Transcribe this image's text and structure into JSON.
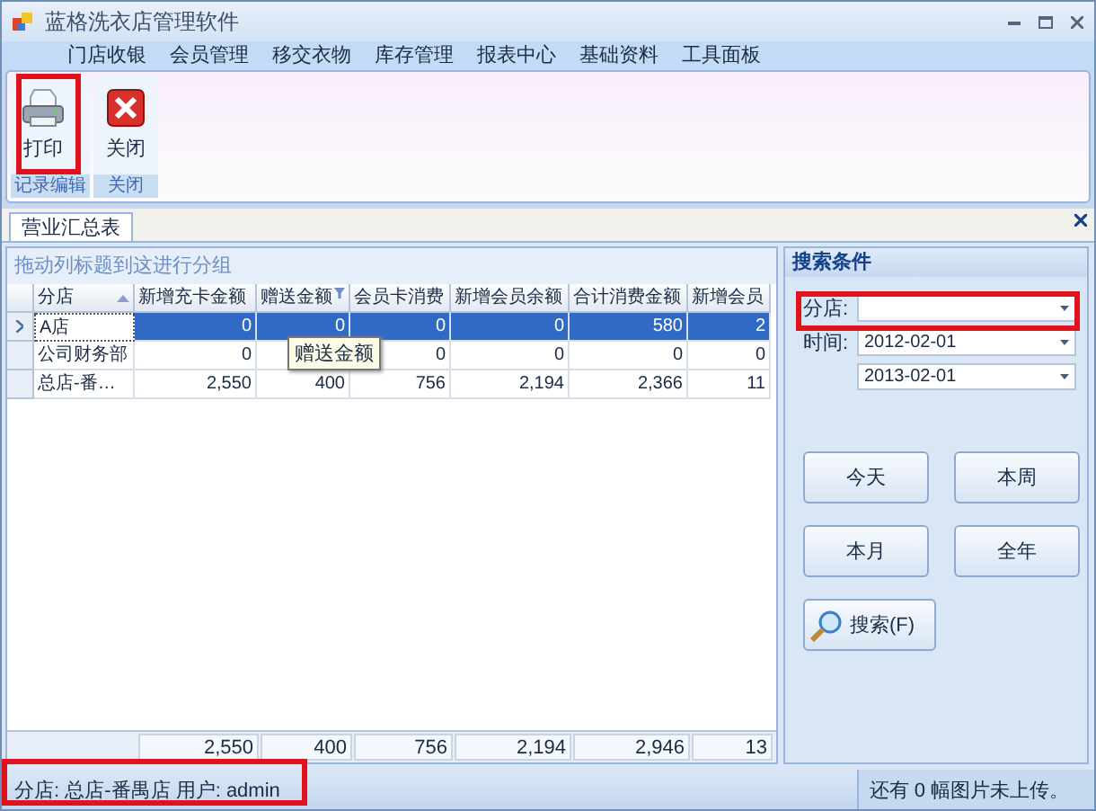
{
  "window": {
    "title": "蓝格洗衣店管理软件"
  },
  "menu": [
    "门店收银",
    "会员管理",
    "移交衣物",
    "库存管理",
    "报表中心",
    "基础资料",
    "工具面板"
  ],
  "ribbon": {
    "groups": [
      {
        "label": "记录编辑",
        "highlighted": true,
        "buttons": [
          {
            "label": "打印",
            "kind": "print"
          }
        ]
      },
      {
        "label": "关闭",
        "highlighted": false,
        "buttons": [
          {
            "label": "关闭",
            "kind": "close"
          }
        ]
      }
    ]
  },
  "document_tabs": [
    {
      "label": "营业汇总表",
      "selected": true
    }
  ],
  "grid": {
    "group_hint": "拖动列标题到这进行分组",
    "columns": [
      {
        "label": "分店",
        "sorted": true,
        "filter": false
      },
      {
        "label": "新增充卡金额",
        "sorted": false,
        "filter": false
      },
      {
        "label": "赠送金额",
        "sorted": false,
        "filter": true
      },
      {
        "label": "会员卡消费",
        "sorted": false,
        "filter": false
      },
      {
        "label": "新增会员余额",
        "sorted": false,
        "filter": false
      },
      {
        "label": "合计消费金额",
        "sorted": false,
        "filter": false
      },
      {
        "label": "新增会员",
        "sorted": false,
        "filter": false
      }
    ],
    "rows": [
      {
        "selected": true,
        "cells": [
          "A店",
          "0",
          "0",
          "0",
          "0",
          "580",
          "2"
        ]
      },
      {
        "selected": false,
        "cells": [
          "公司财务部",
          "0",
          null,
          "0",
          "0",
          "0",
          "0"
        ]
      },
      {
        "selected": false,
        "cells": [
          "总店-番…",
          "2,550",
          "400",
          "756",
          "2,194",
          "2,366",
          "11"
        ]
      }
    ],
    "tooltip": "赠送金额",
    "totals": [
      "2,550",
      "400",
      "756",
      "2,194",
      "2,946",
      "13"
    ]
  },
  "search_panel": {
    "title": "搜索条件",
    "branch": {
      "label": "分店:",
      "highlighted": true
    },
    "time": {
      "label": "时间:",
      "from": "2012-02-01",
      "to": "2013-02-01"
    },
    "quick_buttons": [
      "今天",
      "本周",
      "本月",
      "全年"
    ],
    "search_button": "搜索(F)"
  },
  "status_bar": {
    "left": "分店: 总店-番禺店  用户: admin",
    "left_highlighted": true,
    "right": "还有 0 幅图片未上传。"
  }
}
